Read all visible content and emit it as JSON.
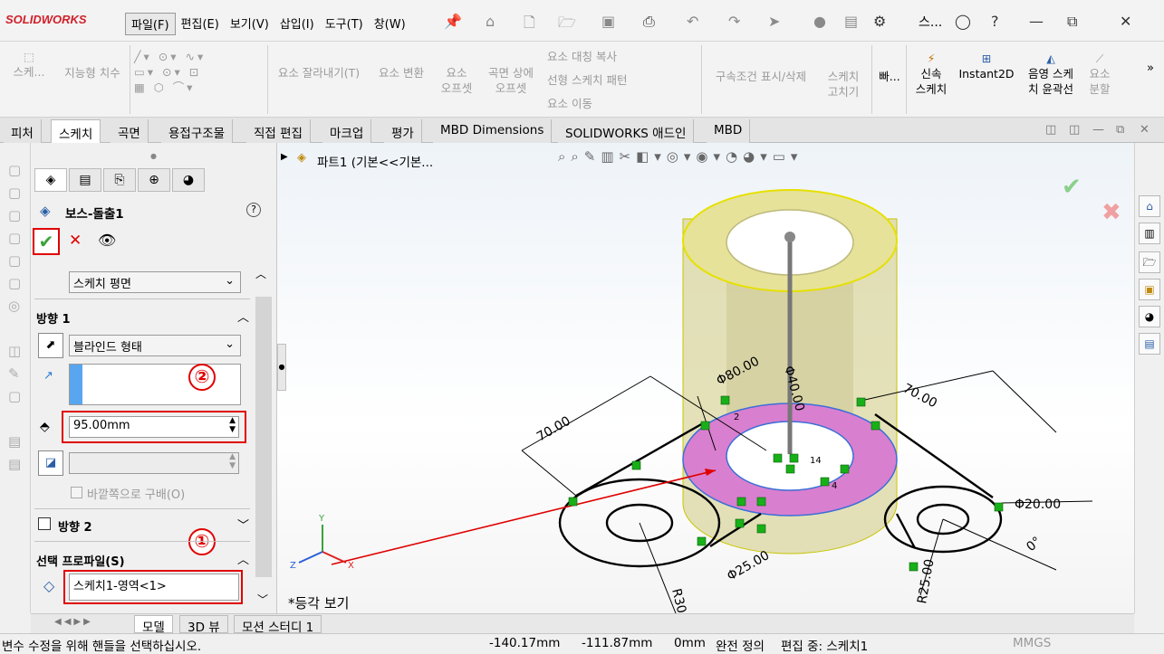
{
  "app": {
    "logo": "SOLIDWORKS"
  },
  "menu": [
    "파일(F)",
    "편집(E)",
    "보기(V)",
    "삽입(I)",
    "도구(T)",
    "창(W)"
  ],
  "title_abbrev": "스...",
  "ribbon": {
    "smart_dim": "지능형 치수",
    "sketch_btn": "스케...",
    "trim": "요소 잘라내기(T)",
    "convert": "요소 변환",
    "offset_1": "요소",
    "offset_2": "오프셋",
    "surface_offset_1": "곡면 상에",
    "surface_offset_2": "오프셋",
    "mirror": "요소 대칭 복사",
    "linear_pattern": "선형 스케치 패턴",
    "move": "요소 이동",
    "relations": "구속조건 표시/삭제",
    "repair_1": "스케치",
    "repair_2": "고치기",
    "quick_snaps": "빠...",
    "rapid_1": "신속",
    "rapid_2": "스케치",
    "instant2d": "Instant2D",
    "shaded_1": "음영 스케",
    "shaded_2": "치 윤곽선",
    "split_1": "요소",
    "split_2": "분할"
  },
  "tabs": [
    "피처",
    "스케치",
    "곡면",
    "용접구조물",
    "직접 편집",
    "마크업",
    "평가",
    "MBD Dimensions",
    "SOLIDWORKS 애드인",
    "MBD"
  ],
  "active_tab": "스케치",
  "tree_header": "파트1  (기본<<기본...",
  "property_manager": {
    "title": "보스-돌출1",
    "from": "스케치 평면",
    "direction1_label": "방향 1",
    "end_condition": "블라인드 형태",
    "depth": "95.00mm",
    "draft_outward": "바깥쪽으로 구배(O)",
    "direction2_label": "방향 2",
    "selected_contours_label": "선택 프로파일(S)",
    "selected_contour_item": "스케치1-영역<1>",
    "annotation_1": "①",
    "annotation_2": "②"
  },
  "viewport": {
    "dims": {
      "d80": "Φ80.00",
      "d40": "Φ40.00",
      "l70a": "70.00",
      "l70b": "70.00",
      "d20": "Φ20.00",
      "d25": "Φ25.00",
      "r25": "R25.00",
      "r30": "R30.0",
      "ang": "0°",
      "rel2": "2",
      "rel14": "14",
      "rel4": "4"
    },
    "view_label": "*등각 보기",
    "triad_x": "X",
    "triad_y": "Y",
    "triad_z": "Z"
  },
  "bottom_tabs": [
    "모델",
    "3D 뷰",
    "모션 스터디 1"
  ],
  "status": {
    "message": "변수 수정을 위해 핸들을 선택하십시오.",
    "x": "-140.17mm",
    "y": "-111.87mm",
    "z": "0mm",
    "state": "완전 정의",
    "editing": "편집 중: 스케치1",
    "units": "MMGS"
  },
  "colors": {
    "accent_red": "#e00000",
    "extrude_preview": "#e6e29a",
    "selected_region": "#d97fcf",
    "ok_green": "#3aa33a"
  }
}
